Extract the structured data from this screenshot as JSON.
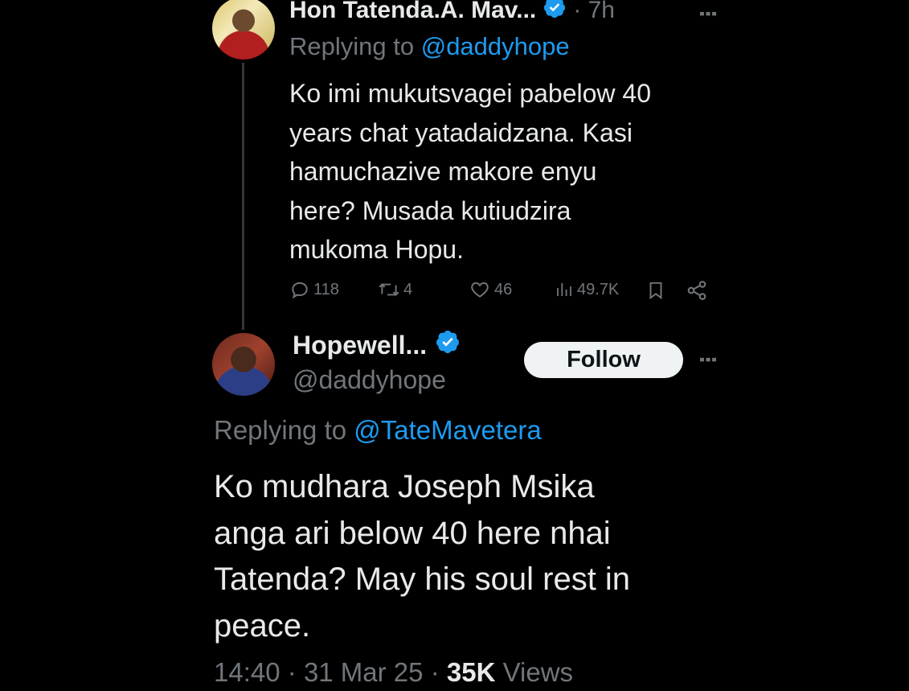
{
  "tweet1": {
    "author_name": "Hon Tatenda.A. Mav...",
    "time": "· 7h",
    "replying_prefix": "Replying to",
    "replying_handle": "@daddyhope",
    "text_lines": [
      "Ko imi mukutsvagei pabelow 40",
      "years chat yatadaidzana. Kasi",
      "hamuchazive makore enyu",
      "here? Musada kutiudzira",
      "mukoma Hopu."
    ],
    "stats": {
      "replies": "118",
      "reposts": "4",
      "likes": "46",
      "views": "49.7K"
    }
  },
  "tweet2": {
    "author_name": "Hopewell...",
    "handle": "@daddyhope",
    "follow_label": "Follow",
    "replying_prefix": "Replying to",
    "replying_handle": "@TateMavetera",
    "text_lines": [
      "Ko mudhara Joseph Msika",
      "anga ari below 40 here nhai",
      "Tatenda? May his soul rest in",
      "peace."
    ],
    "time": "14:40",
    "date": "31 Mar 25",
    "views_count": "35K",
    "views_label": "Views"
  },
  "colors": {
    "background": "#000000",
    "text": "#e7e9ea",
    "muted": "#71767b",
    "link": "#1d9bf0",
    "verified": "#1d9bf0"
  },
  "icons": [
    "verified-badge-icon",
    "more-icon",
    "reply-icon",
    "repost-icon",
    "like-icon",
    "views-icon",
    "bookmark-icon",
    "share-icon"
  ]
}
